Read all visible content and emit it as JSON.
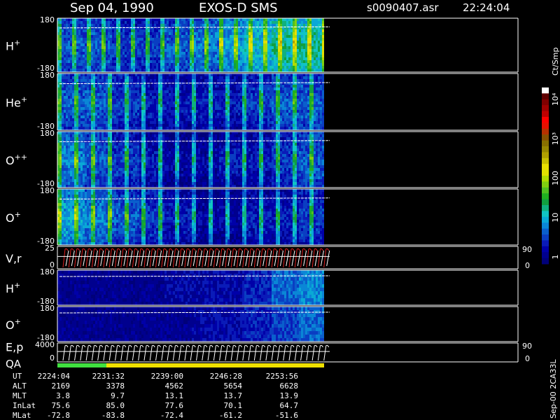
{
  "header": {
    "date": "Sep 04, 1990",
    "instrument": "EXOS-D SMS",
    "file": "s0090407.asr",
    "time": "22:24:04"
  },
  "colorbar": {
    "label": "Ct/Smp",
    "ticks": [
      "1",
      "10",
      "100",
      "10³",
      "10⁴"
    ],
    "tick_values": [
      1,
      10,
      100,
      1000,
      10000
    ],
    "colors": [
      "#00007a",
      "#00008e",
      "#0000a8",
      "#0a1bb8",
      "#0a3ec2",
      "#0a5fcc",
      "#0a86d6",
      "#0aa8d6",
      "#10c4c4",
      "#10b080",
      "#10a040",
      "#20b020",
      "#50c020",
      "#80d010",
      "#b0dc00",
      "#e0e000",
      "#e8e000",
      "#c8c000",
      "#b0a000",
      "#988800",
      "#887000",
      "#885000",
      "#b83000",
      "#e81000",
      "#ff0000",
      "#c00000",
      "#a00000",
      "#800000",
      "#600000",
      "#ffffff"
    ]
  },
  "footer": {
    "side_label": "Sep-00 2CA33L",
    "row_labels": [
      "UT",
      "ALT",
      "MLT",
      "InLat",
      "MLat"
    ],
    "columns": [
      {
        "UT": "2224:04",
        "ALT": "2169",
        "MLT": "3.8",
        "InLat": "75.6",
        "MLat": "-72.8"
      },
      {
        "UT": "2231:32",
        "ALT": "3378",
        "MLT": "9.7",
        "InLat": "85.0",
        "MLat": "-83.8"
      },
      {
        "UT": "2239:00",
        "ALT": "4562",
        "MLT": "13.1",
        "InLat": "77.6",
        "MLat": "-72.4"
      },
      {
        "UT": "2246:28",
        "ALT": "5654",
        "MLT": "13.7",
        "InLat": "70.1",
        "MLat": "-61.2"
      },
      {
        "UT": "2253:56",
        "ALT": "6628",
        "MLT": "13.9",
        "InLat": "64.7",
        "MLat": "-51.6"
      }
    ]
  },
  "chart_data": {
    "type": "heatmap",
    "x_axis": "UT",
    "x_ticks": [
      "2224:04",
      "2231:32",
      "2239:00",
      "2246:28",
      "2253:56"
    ],
    "panels": [
      {
        "id": "h-plus",
        "label": "H",
        "sup": "+",
        "ymin": "-180",
        "ymax": "180",
        "kind": "pitch",
        "intensity": [
          5,
          5,
          4,
          4,
          5,
          6,
          7,
          8,
          9,
          9
        ],
        "stripe_period": 7,
        "stripe_strength": 0.85
      },
      {
        "id": "he-plus",
        "label": "He",
        "sup": "+",
        "ymin": "-180",
        "ymax": "180",
        "kind": "pitch",
        "intensity": [
          5,
          5,
          4,
          3,
          3,
          3,
          3,
          4,
          5,
          5
        ],
        "stripe_period": 8,
        "stripe_strength": 0.75
      },
      {
        "id": "o-pp",
        "label": "O",
        "sup": "++",
        "ymin": "-180",
        "ymax": "180",
        "kind": "pitch",
        "intensity": [
          6,
          5,
          4,
          3,
          2,
          2,
          3,
          3,
          4,
          5
        ],
        "stripe_period": 8,
        "stripe_strength": 0.8
      },
      {
        "id": "o-plus",
        "label": "O",
        "sup": "+",
        "ymin": "-180",
        "ymax": "180",
        "kind": "pitch",
        "intensity": [
          7,
          6,
          5,
          4,
          3,
          2,
          2,
          3,
          3,
          4
        ],
        "stripe_period": 8,
        "stripe_strength": 0.8
      },
      {
        "id": "vr",
        "label": "V,r",
        "sup": "",
        "ymin": "0",
        "ymax": "25",
        "kind": "line",
        "right_top": "90",
        "right_bottom": "0"
      },
      {
        "id": "h-plus-2",
        "label": "H",
        "sup": "+",
        "ymin": "-180",
        "ymax": "180",
        "kind": "energy",
        "intensity": [
          1,
          1,
          1,
          1,
          2,
          2,
          2,
          3,
          5,
          6
        ]
      },
      {
        "id": "o-plus-2",
        "label": "O",
        "sup": "+",
        "ymin": "-180",
        "ymax": "180",
        "kind": "energy",
        "intensity": [
          1,
          1,
          1,
          1,
          1,
          2,
          2,
          3,
          4,
          5
        ]
      },
      {
        "id": "ep",
        "label": "E,p",
        "sup": "",
        "label2": "QA",
        "ymin": "0",
        "ymax": "4000",
        "kind": "line",
        "right_top": "90",
        "right_bottom": "0"
      }
    ]
  }
}
